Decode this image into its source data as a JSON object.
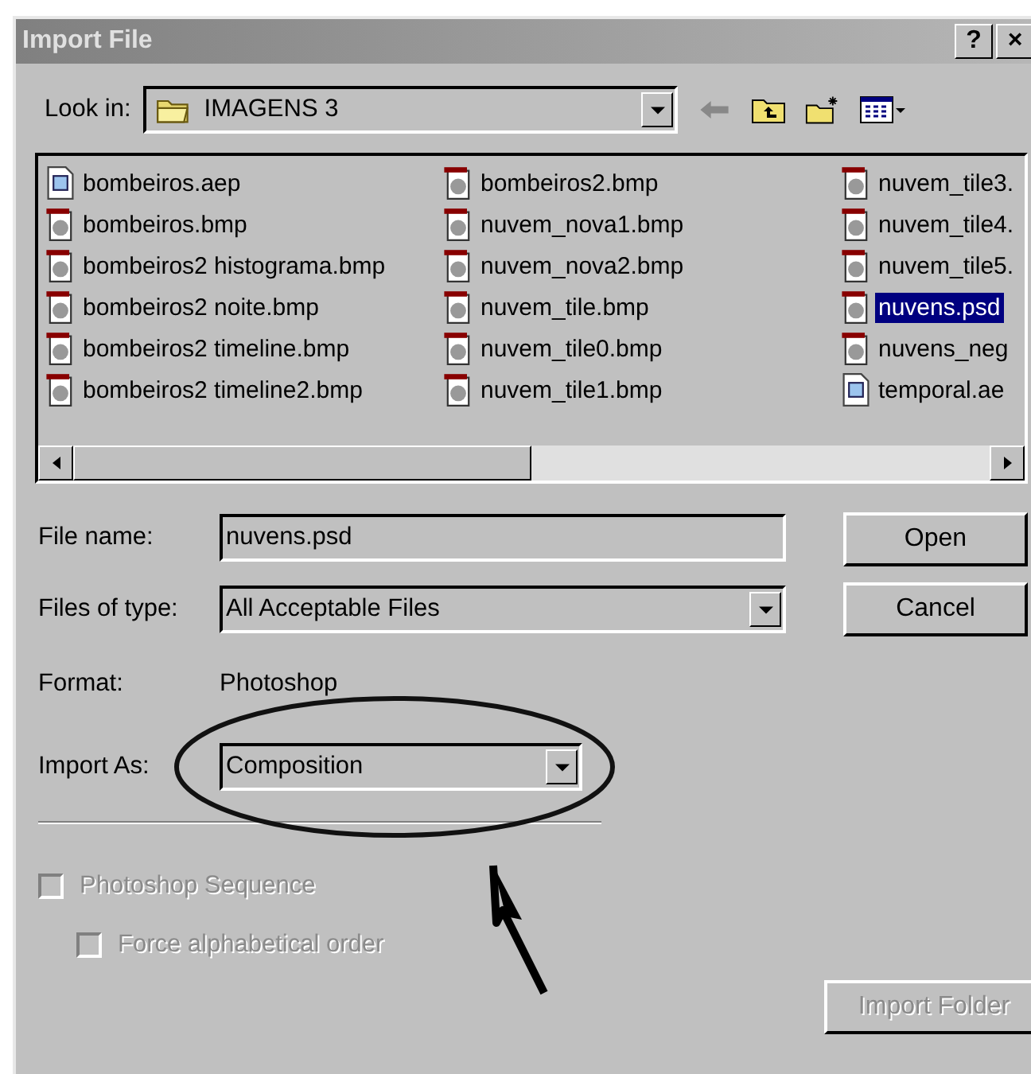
{
  "window": {
    "title": "Import File",
    "help_button": "?",
    "close_button": "×"
  },
  "look_in": {
    "label": "Look in:",
    "value": "IMAGENS 3"
  },
  "files": [
    {
      "name": "bombeiros.aep",
      "kind": "project",
      "selected": false
    },
    {
      "name": "bombeiros.bmp",
      "kind": "image",
      "selected": false
    },
    {
      "name": "bombeiros2 histograma.bmp",
      "kind": "image",
      "selected": false
    },
    {
      "name": "bombeiros2 noite.bmp",
      "kind": "image",
      "selected": false
    },
    {
      "name": "bombeiros2 timeline.bmp",
      "kind": "image",
      "selected": false
    },
    {
      "name": "bombeiros2 timeline2.bmp",
      "kind": "image",
      "selected": false
    },
    {
      "name": "bombeiros2.bmp",
      "kind": "image",
      "selected": false
    },
    {
      "name": "nuvem_nova1.bmp",
      "kind": "image",
      "selected": false
    },
    {
      "name": "nuvem_nova2.bmp",
      "kind": "image",
      "selected": false
    },
    {
      "name": "nuvem_tile.bmp",
      "kind": "image",
      "selected": false
    },
    {
      "name": "nuvem_tile0.bmp",
      "kind": "image",
      "selected": false
    },
    {
      "name": "nuvem_tile1.bmp",
      "kind": "image",
      "selected": false
    },
    {
      "name": "nuvem_tile3.",
      "kind": "image",
      "selected": false
    },
    {
      "name": "nuvem_tile4.",
      "kind": "image",
      "selected": false
    },
    {
      "name": "nuvem_tile5.",
      "kind": "image",
      "selected": false
    },
    {
      "name": "nuvens.psd",
      "kind": "image",
      "selected": true
    },
    {
      "name": "nuvens_neg",
      "kind": "image",
      "selected": false
    },
    {
      "name": "temporal.ae",
      "kind": "project",
      "selected": false
    }
  ],
  "file_name": {
    "label": "File name:",
    "value": "nuvens.psd"
  },
  "files_of_type": {
    "label": "Files of type:",
    "value": "All Acceptable Files"
  },
  "format": {
    "label": "Format:",
    "value": "Photoshop"
  },
  "import_as": {
    "label": "Import As:",
    "value": "Composition"
  },
  "options": [
    {
      "label": "Photoshop Sequence",
      "checked": false,
      "disabled": true,
      "indented": false
    },
    {
      "label": "Force alphabetical order",
      "checked": false,
      "disabled": true,
      "indented": true
    }
  ],
  "buttons": [
    {
      "label": "Open",
      "disabled": false
    },
    {
      "label": "Cancel",
      "disabled": false
    },
    {
      "label": "Import Folder",
      "disabled": true
    }
  ]
}
